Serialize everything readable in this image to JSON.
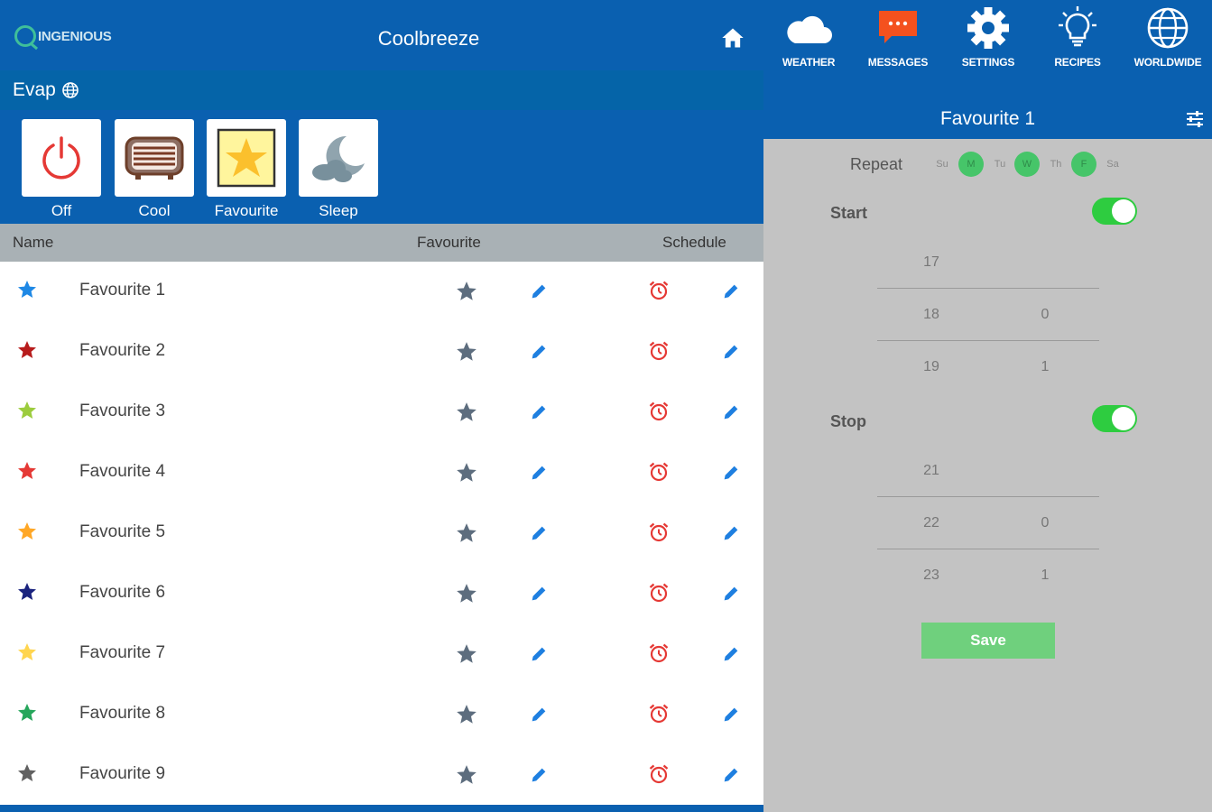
{
  "header": {
    "logo_text": "INGENIOUS",
    "title": "Coolbreeze"
  },
  "mode": {
    "name": "Evap"
  },
  "mode_tiles": [
    {
      "label": "Off",
      "icon": "power-icon"
    },
    {
      "label": "Cool",
      "icon": "vent-icon"
    },
    {
      "label": "Favourite",
      "icon": "star-icon"
    },
    {
      "label": "Sleep",
      "icon": "moon-icon"
    }
  ],
  "table": {
    "headers": {
      "name": "Name",
      "favourite": "Favourite",
      "schedule": "Schedule"
    },
    "rows": [
      {
        "name": "Favourite 1",
        "color": "#1e88e5"
      },
      {
        "name": "Favourite 2",
        "color": "#b71c1c"
      },
      {
        "name": "Favourite 3",
        "color": "#9ccc3d"
      },
      {
        "name": "Favourite 4",
        "color": "#e53935"
      },
      {
        "name": "Favourite 5",
        "color": "#ffa726"
      },
      {
        "name": "Favourite 6",
        "color": "#1a237e"
      },
      {
        "name": "Favourite 7",
        "color": "#ffd54f"
      },
      {
        "name": "Favourite 8",
        "color": "#26a65b"
      },
      {
        "name": "Favourite 9",
        "color": "#616161"
      }
    ]
  },
  "nav": [
    {
      "label": "WEATHER",
      "icon": "cloud-icon"
    },
    {
      "label": "MESSAGES",
      "icon": "message-icon"
    },
    {
      "label": "SETTINGS",
      "icon": "gear-icon"
    },
    {
      "label": "RECIPES",
      "icon": "lightbulb-icon"
    },
    {
      "label": "WORLDWIDE",
      "icon": "globe-icon"
    }
  ],
  "schedule": {
    "title": "Favourite 1",
    "repeat_label": "Repeat",
    "days": [
      {
        "label": "Su",
        "selected": false
      },
      {
        "label": "M",
        "selected": true
      },
      {
        "label": "Tu",
        "selected": false
      },
      {
        "label": "W",
        "selected": true
      },
      {
        "label": "Th",
        "selected": false
      },
      {
        "label": "F",
        "selected": true
      },
      {
        "label": "Sa",
        "selected": false
      }
    ],
    "start": {
      "label": "Start",
      "enabled": true,
      "rows": [
        {
          "hour": "17",
          "minute": ""
        },
        {
          "hour": "18",
          "minute": "0"
        },
        {
          "hour": "19",
          "minute": "1"
        }
      ]
    },
    "stop": {
      "label": "Stop",
      "enabled": true,
      "rows": [
        {
          "hour": "21",
          "minute": ""
        },
        {
          "hour": "22",
          "minute": "0"
        },
        {
          "hour": "23",
          "minute": "1"
        }
      ]
    },
    "save_label": "Save"
  },
  "colors": {
    "primary_blue": "#0a60b0",
    "mode_bar_blue": "#0564a8",
    "header_gray": "#a9b1b5",
    "panel_gray": "#c3c3c3",
    "alarm_red": "#e53935",
    "edit_blue": "#1e7fe0",
    "toggle_green": "#2ecc40",
    "save_green": "#6fd07d"
  }
}
